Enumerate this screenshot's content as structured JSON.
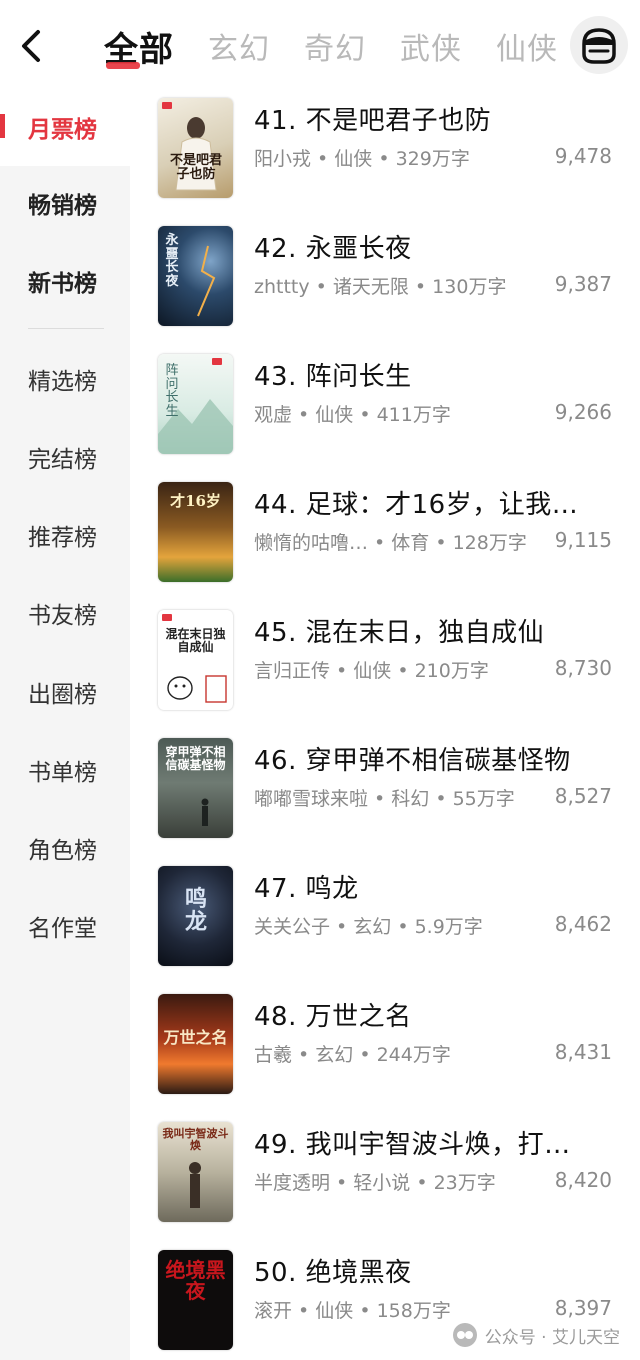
{
  "header": {
    "tabs": [
      {
        "label": "全部",
        "active": true
      },
      {
        "label": "玄幻",
        "active": false
      },
      {
        "label": "奇幻",
        "active": false
      },
      {
        "label": "武侠",
        "active": false
      },
      {
        "label": "仙侠",
        "active": false
      }
    ],
    "back_icon": "chevron-left-icon",
    "profile_icon": "person-face-icon"
  },
  "sidebar": {
    "items": [
      {
        "label": "月票榜",
        "active": true
      },
      {
        "label": "畅销榜"
      },
      {
        "label": "新书榜"
      },
      {
        "label": "精选榜"
      },
      {
        "label": "完结榜"
      },
      {
        "label": "推荐榜"
      },
      {
        "label": "书友榜"
      },
      {
        "label": "出圈榜"
      },
      {
        "label": "书单榜"
      },
      {
        "label": "角色榜"
      },
      {
        "label": "名作堂"
      }
    ]
  },
  "colors": {
    "accent": "#e33640"
  },
  "books": [
    {
      "title": "41. 不是吧君子也防",
      "meta": "阳小戎 • 仙侠 • 329万字",
      "votes": "9,478",
      "cover_text": "不是吧君子也防"
    },
    {
      "title": "42. 永噩长夜",
      "meta": "zhttty • 诸天无限 • 130万字",
      "votes": "9,387",
      "cover_text": "永噩长夜"
    },
    {
      "title": "43. 阵问长生",
      "meta": "观虚 • 仙侠 • 411万字",
      "votes": "9,266",
      "cover_text": "阵问长生"
    },
    {
      "title": "44. 足球：才16岁，让我…",
      "meta": "懒惰的咕噜… • 体育 • 128万字",
      "votes": "9,115",
      "cover_text": "才16岁"
    },
    {
      "title": "45. 混在末日，独自成仙",
      "meta": "言归正传 • 仙侠 • 210万字",
      "votes": "8,730",
      "cover_text": "混在末日独自成仙"
    },
    {
      "title": "46. 穿甲弹不相信碳基怪物",
      "meta": "嘟嘟雪球来啦 • 科幻 • 55万字",
      "votes": "8,527",
      "cover_text": "穿甲弹不相信碳基怪物"
    },
    {
      "title": "47. 鸣龙",
      "meta": "关关公子 • 玄幻 • 5.9万字",
      "votes": "8,462",
      "cover_text": "鸣龙"
    },
    {
      "title": "48. 万世之名",
      "meta": "古羲 • 玄幻 • 244万字",
      "votes": "8,431",
      "cover_text": "万世之名"
    },
    {
      "title": "49. 我叫宇智波斗焕，打…",
      "meta": "半度透明 • 轻小说 • 23万字",
      "votes": "8,420",
      "cover_text": "我叫宇智波斗焕"
    },
    {
      "title": "50. 绝境黑夜",
      "meta": "滚开 • 仙侠 • 158万字",
      "votes": "8,397",
      "cover_text": "绝境黑夜"
    }
  ],
  "watermark": {
    "text": "公众号 · 艾儿天空"
  }
}
